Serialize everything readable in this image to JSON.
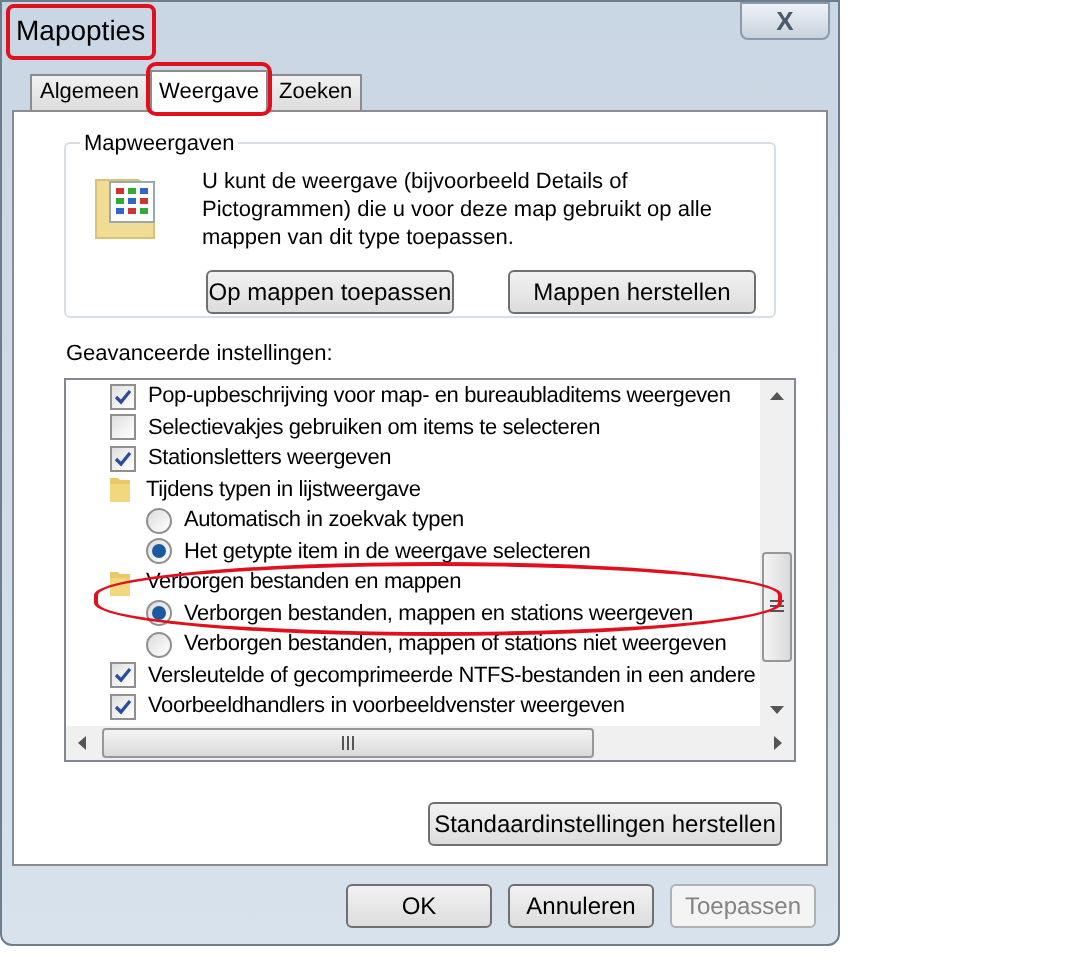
{
  "window": {
    "title": "Mapopties",
    "highlighted": true,
    "close": "X"
  },
  "tabs": [
    {
      "label": "Algemeen",
      "selected": false,
      "highlighted": false
    },
    {
      "label": "Weergave",
      "selected": true,
      "highlighted": true
    },
    {
      "label": "Zoeken",
      "selected": false,
      "highlighted": false
    }
  ],
  "folder_views": {
    "title": "Mapweergaven",
    "text": "U kunt de weergave (bijvoorbeeld Details of Pictogrammen) die u voor deze map gebruikt op alle mappen van dit type toepassen.",
    "buttons": [
      "Op mappen toepassen",
      "Mappen herstellen"
    ]
  },
  "advanced": {
    "label": "Geavanceerde instellingen:",
    "items": [
      {
        "kind": "checkbox",
        "label": "Pop-upbeschrijving voor map- en bureaubladitems weergeven",
        "checked": true
      },
      {
        "kind": "checkbox",
        "label": "Selectievakjes gebruiken om items te selecteren",
        "checked": false
      },
      {
        "kind": "checkbox",
        "label": "Stationsletters weergeven",
        "checked": true
      },
      {
        "kind": "folder",
        "label": "Tijdens typen in lijstweergave",
        "highlighted": false,
        "children": [
          {
            "kind": "radio",
            "label": "Automatisch in zoekvak typen",
            "selected": false
          },
          {
            "kind": "radio",
            "label": "Het getypte item in de weergave selecteren",
            "selected": true
          }
        ]
      },
      {
        "kind": "folder",
        "label": "Verborgen bestanden en mappen",
        "highlighted": true,
        "children": [
          {
            "kind": "radio",
            "label": "Verborgen bestanden, mappen en stations weergeven",
            "selected": true
          },
          {
            "kind": "radio",
            "label": "Verborgen bestanden, mappen of stations niet weergeven",
            "selected": false
          }
        ]
      },
      {
        "kind": "checkbox",
        "label": "Versleutelde of gecomprimeerde NTFS-bestanden in een andere",
        "checked": true
      },
      {
        "kind": "checkbox",
        "label": "Voorbeeldhandlers in voorbeeldvenster weergeven",
        "checked": true
      }
    ],
    "restore_button": "Standaardinstellingen herstellen"
  },
  "buttons": [
    {
      "label": "OK",
      "disabled": false
    },
    {
      "label": "Annuleren",
      "disabled": false
    },
    {
      "label": "Toepassen",
      "disabled": true
    }
  ]
}
